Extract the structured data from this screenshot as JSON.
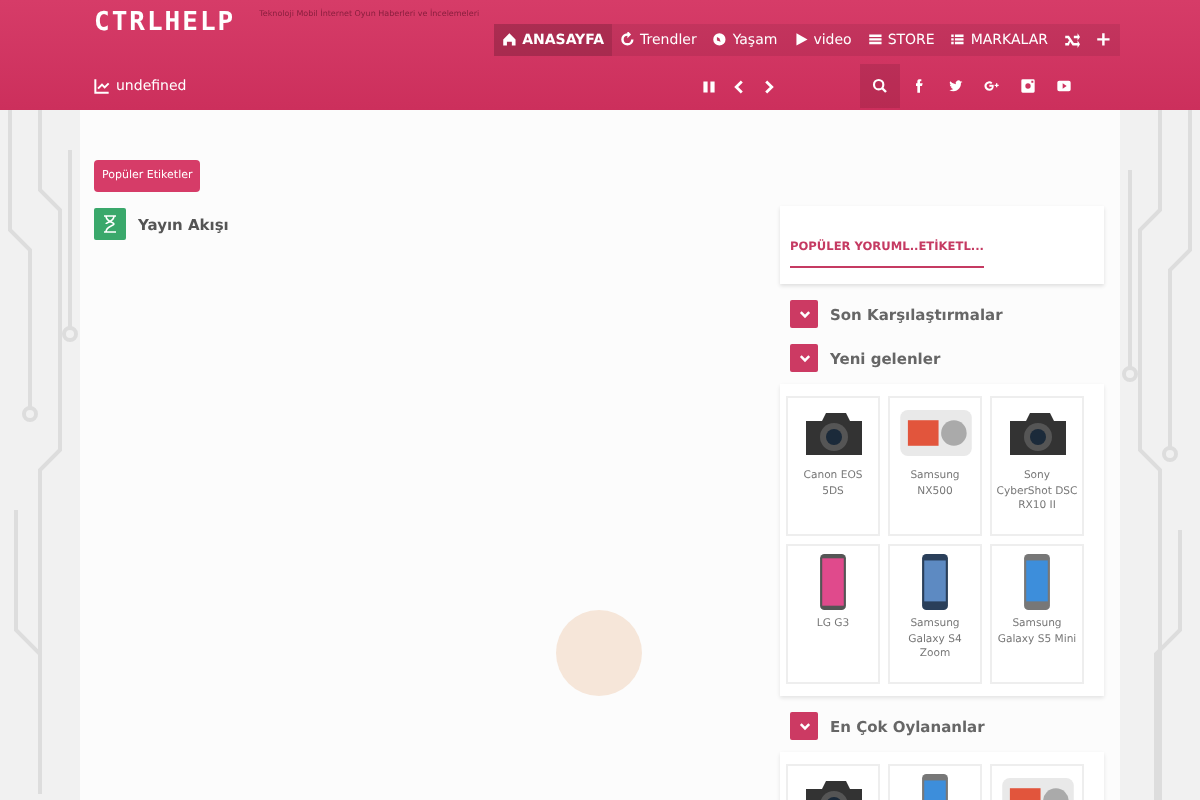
{
  "header": {
    "logo": "CTRLHELP",
    "tagline": "Teknoloji Mobil İnternet Oyun Haberleri ve İncelemeleri",
    "nav": [
      {
        "label": "ANASAYFA",
        "selected": true
      },
      {
        "label": "Trendler",
        "selected": false
      },
      {
        "label": "Yaşam",
        "selected": false
      },
      {
        "label": "video",
        "selected": false
      },
      {
        "label": "STORE",
        "selected": false
      },
      {
        "label": "MARKALAR",
        "selected": false
      },
      {
        "kind": "shuffle",
        "selected": false
      },
      {
        "kind": "plus",
        "selected": false
      }
    ],
    "ticker": "undefined"
  },
  "tags_button": "Popüler Etiketler",
  "feed_title": "Yayın Akışı",
  "sidebar": {
    "tab": "POPÜLER YORUML..ETİKETL...",
    "sections": [
      {
        "title": "Son Karşılaştırmalar"
      },
      {
        "title": "Yeni gelenler",
        "products": [
          {
            "name": "Canon EOS 5DS",
            "kind": "camera"
          },
          {
            "name": "Samsung NX500",
            "kind": "mirrorless"
          },
          {
            "name": "Sony CyberShot DSC RX10 II",
            "kind": "camera"
          },
          {
            "name": "LG G3",
            "kind": "phone-pink"
          },
          {
            "name": "Samsung Galaxy S4 Zoom",
            "kind": "phone-dark"
          },
          {
            "name": "Samsung Galaxy S5 Mini",
            "kind": "phone-blue"
          }
        ]
      },
      {
        "title": "En Çok Oylananlar",
        "products": [
          {
            "kind": "camera"
          },
          {
            "kind": "phone-blue"
          },
          {
            "kind": "mirrorless"
          }
        ]
      }
    ]
  }
}
